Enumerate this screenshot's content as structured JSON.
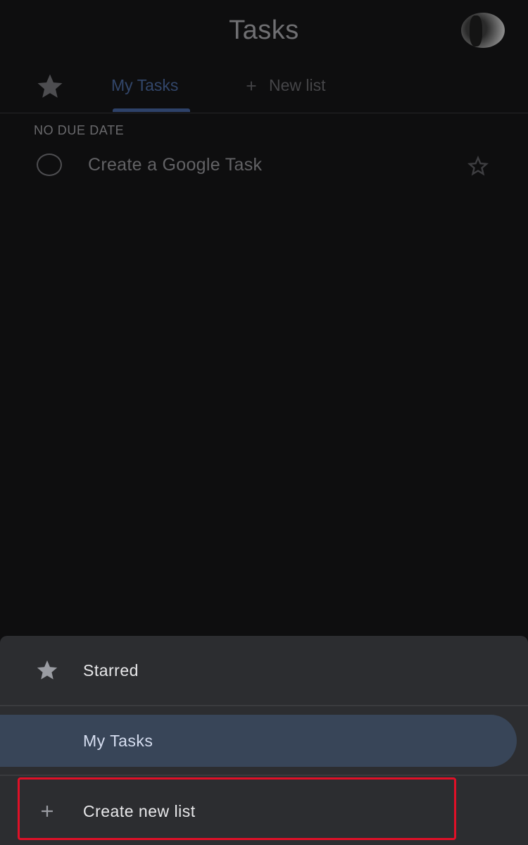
{
  "app": {
    "title": "Tasks"
  },
  "tabs": {
    "starred_icon": "star-icon",
    "active_label": "My Tasks",
    "new_list_label": "New list",
    "new_list_icon": "plus-icon"
  },
  "list": {
    "section_label": "NO DUE DATE",
    "tasks": [
      {
        "title": "Create a Google Task",
        "completed": false,
        "starred": false
      }
    ]
  },
  "sheet": {
    "items": [
      {
        "label": "Starred",
        "icon": "star-icon"
      },
      {
        "label": "My Tasks",
        "icon": "",
        "selected": true
      },
      {
        "label": "Create new list",
        "icon": "plus-icon"
      }
    ]
  },
  "colors": {
    "background": "#0e0e0f",
    "sheet": "#2c2d30",
    "selected": "#384558",
    "highlight": "#e01027"
  }
}
